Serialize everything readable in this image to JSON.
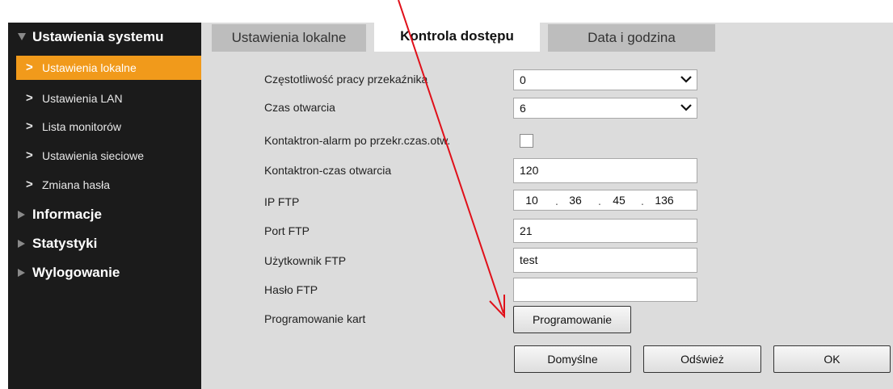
{
  "sidebar": {
    "groups": [
      {
        "label": "Ustawienia systemu",
        "expanded": true
      },
      {
        "label": "Informacje",
        "expanded": false
      },
      {
        "label": "Statystyki",
        "expanded": false
      },
      {
        "label": "Wylogowanie",
        "expanded": false
      }
    ],
    "items": [
      {
        "label": "Ustawienia lokalne",
        "active": true
      },
      {
        "label": "Ustawienia LAN",
        "active": false
      },
      {
        "label": "Lista monitorów",
        "active": false
      },
      {
        "label": "Ustawienia sieciowe",
        "active": false
      },
      {
        "label": "Zmiana hasła",
        "active": false
      }
    ],
    "chevron": ">"
  },
  "tabs": [
    {
      "label": "Ustawienia lokalne",
      "active": false
    },
    {
      "label": "Kontrola dostępu",
      "active": true
    },
    {
      "label": "Data i godzina",
      "active": false
    }
  ],
  "form": {
    "relay_frequency": {
      "label": "Częstotliwość pracy przekaźnika",
      "value": "0"
    },
    "open_time": {
      "label": "Czas otwarcia",
      "value": "6"
    },
    "reed_alarm": {
      "label": "Kontaktron-alarm po przekr.czas.otw.",
      "checked": false
    },
    "reed_time": {
      "label": "Kontaktron-czas otwarcia",
      "value": "120"
    },
    "ftp_ip": {
      "label": "IP FTP",
      "octets": [
        "10",
        "36",
        "45",
        "136"
      ],
      "separator": "."
    },
    "ftp_port": {
      "label": "Port FTP",
      "value": "21"
    },
    "ftp_user": {
      "label": "Użytkownik FTP",
      "value": "test"
    },
    "ftp_password": {
      "label": "Hasło FTP",
      "value": ""
    },
    "card_programming": {
      "label": "Programowanie kart",
      "button_label": "Programowanie"
    }
  },
  "actions": {
    "default_label": "Domyślne",
    "refresh_label": "Odśwież",
    "ok_label": "OK"
  },
  "colors": {
    "sidebar_bg": "#1b1b1b",
    "active_item": "#f19a1b",
    "panel_bg": "#dcdcdc",
    "annotation_arrow": "#e0101a"
  }
}
